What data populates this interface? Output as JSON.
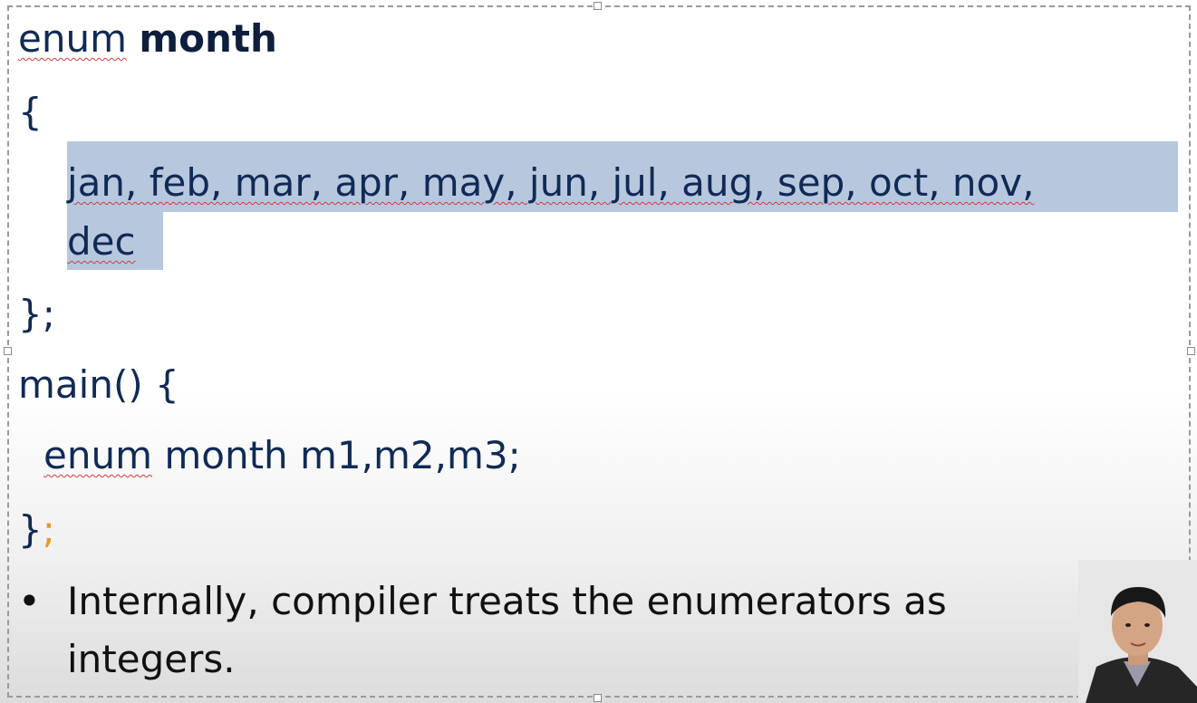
{
  "code": {
    "enum_keyword": "enum",
    "enum_name": "month",
    "open_brace": "{",
    "values_line1": "jan, feb, mar, apr, may, jun, jul, aug, sep, oct, nov,",
    "values_line2": "dec",
    "close_brace_semicolon": "};",
    "main_signature": "main() {",
    "decl_keyword": "enum",
    "decl_rest": " month m1,m2,m3;",
    "main_close_brace": "}",
    "main_close_semicolon": ";"
  },
  "bullet": {
    "symbol": "•",
    "line1": "Internally, compiler treats the enumerators as",
    "line2": "integers."
  },
  "colors": {
    "code_text": "#102a55",
    "selection_highlight": "#b7c8de",
    "spellcheck_underline": "#d23a3a"
  }
}
